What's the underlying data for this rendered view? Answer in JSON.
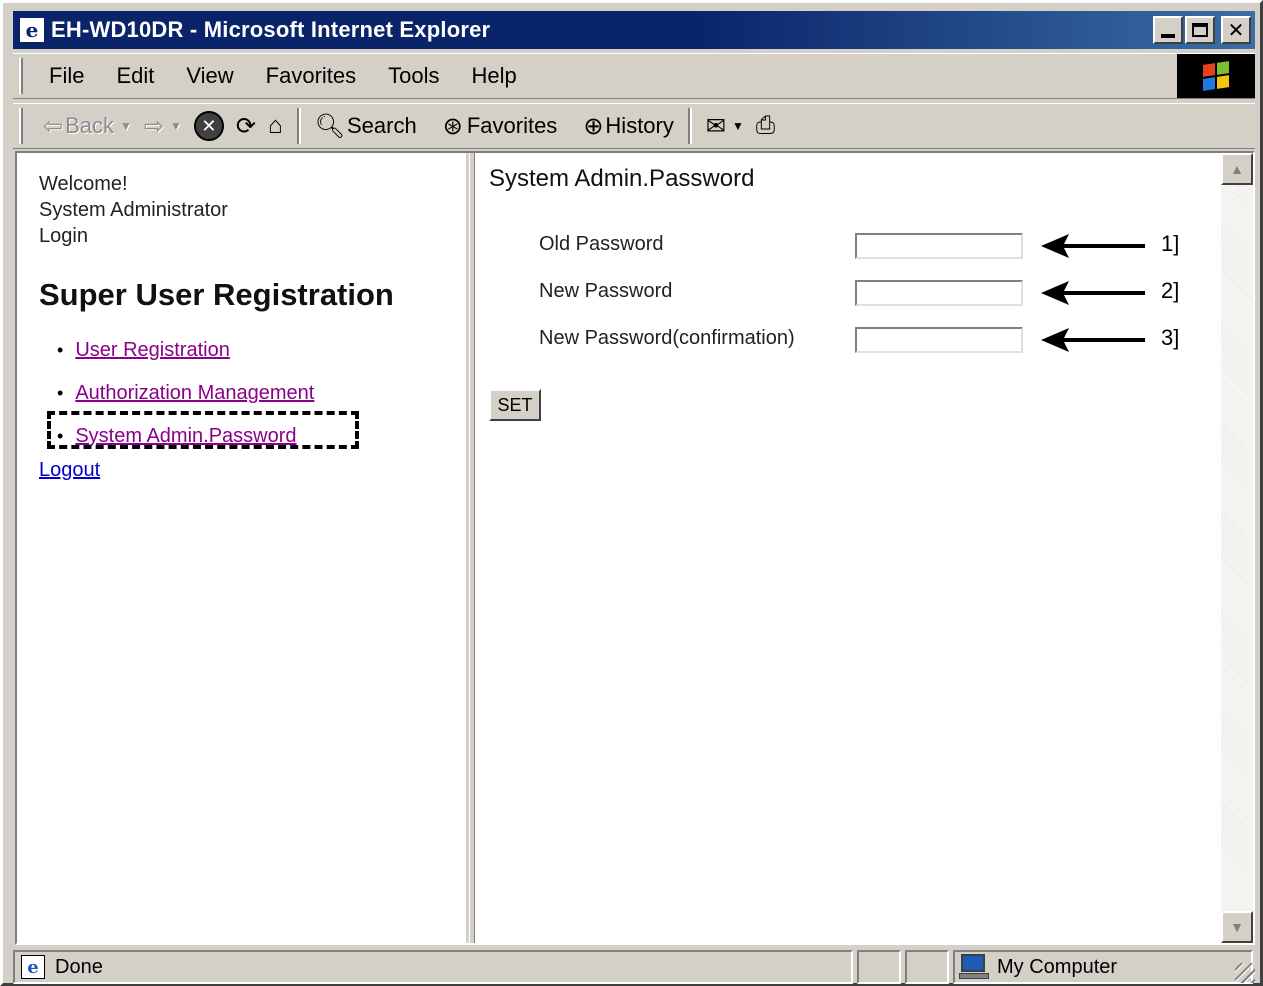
{
  "window": {
    "title": "EH-WD10DR - Microsoft Internet Explorer"
  },
  "menu": [
    "File",
    "Edit",
    "View",
    "Favorites",
    "Tools",
    "Help"
  ],
  "toolbar": {
    "back_label": "Back",
    "search_label": "Search",
    "favorites_label": "Favorites",
    "history_label": "History"
  },
  "left": {
    "welcome": "Welcome!",
    "role": "System Administrator",
    "login": "Login",
    "heading": "Super User Registration",
    "links": [
      "User Registration",
      "Authorization Management",
      "System Admin.Password"
    ],
    "logout": "Logout"
  },
  "main": {
    "title": "System Admin.Password",
    "fields": [
      {
        "label": "Old Password",
        "value": "",
        "callout": "1]"
      },
      {
        "label": "New Password",
        "value": "",
        "callout": "2]"
      },
      {
        "label": "New Password(confirmation)",
        "value": "",
        "callout": "3]"
      }
    ],
    "set_label": "SET"
  },
  "status": {
    "text": "Done",
    "zone": "My Computer"
  },
  "colors": {
    "titlebar": "#0a246a",
    "visited_link": "#8b008b",
    "link": "#0000cc",
    "chrome": "#d4d0c8"
  },
  "icons": [
    "ie-icon",
    "minimize-icon",
    "maximize-icon",
    "close-icon",
    "windows-logo-icon",
    "back-arrow-icon",
    "forward-arrow-icon",
    "stop-icon",
    "refresh-icon",
    "home-icon",
    "search-icon",
    "favorites-icon",
    "history-icon",
    "mail-icon",
    "print-icon",
    "page-icon",
    "computer-icon"
  ]
}
